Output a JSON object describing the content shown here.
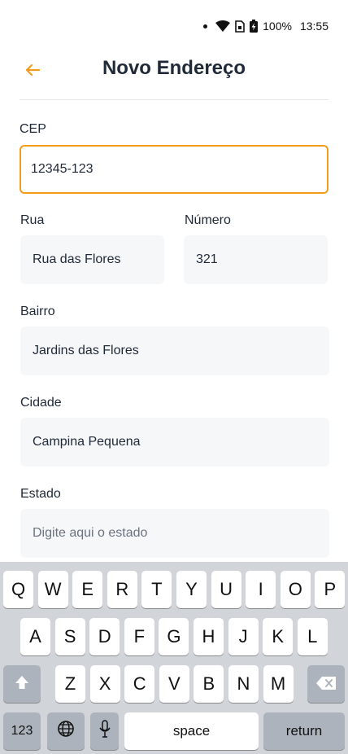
{
  "status_bar": {
    "battery": "100%",
    "time": "13:55"
  },
  "header": {
    "title": "Novo Endereço"
  },
  "form": {
    "cep": {
      "label": "CEP",
      "value": "12345-123"
    },
    "rua": {
      "label": "Rua",
      "value": "Rua das Flores"
    },
    "numero": {
      "label": "Número",
      "value": "321"
    },
    "bairro": {
      "label": "Bairro",
      "value": "Jardins das Flores"
    },
    "cidade": {
      "label": "Cidade",
      "value": "Campina Pequena"
    },
    "estado": {
      "label": "Estado",
      "value": "",
      "placeholder": "Digite aqui o estado"
    }
  },
  "keyboard": {
    "row1": [
      "Q",
      "W",
      "E",
      "R",
      "T",
      "Y",
      "U",
      "I",
      "O",
      "P"
    ],
    "row2": [
      "A",
      "S",
      "D",
      "F",
      "G",
      "H",
      "J",
      "K",
      "L"
    ],
    "row3": [
      "Z",
      "X",
      "C",
      "V",
      "B",
      "N",
      "M"
    ],
    "numbers_label": "123",
    "space_label": "space",
    "return_label": "return"
  },
  "colors": {
    "accent": "#f39c1b",
    "field_bg": "#f6f7f9",
    "keyboard_bg": "#d1d4d9"
  }
}
